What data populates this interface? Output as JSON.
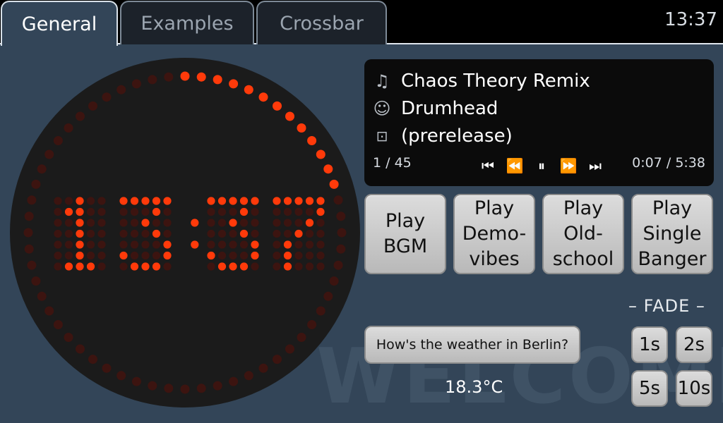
{
  "tabs": [
    {
      "label": "General",
      "active": true
    },
    {
      "label": "Examples",
      "active": false
    },
    {
      "label": "Crossbar",
      "active": false
    }
  ],
  "status_bar": {
    "time": "13:37"
  },
  "clock_display": {
    "hours": "13",
    "minutes": "37",
    "seconds_elapsed": 12,
    "lit_color": "#ff3a0a",
    "dim_color": "#3c1410",
    "face_color": "#1b1b1b"
  },
  "now_playing": {
    "title": "Chaos Theory Remix",
    "artist": "Drumhead",
    "album": "(prerelease)",
    "title_icon": "music-note-icon",
    "artist_icon": "smiley-icon",
    "album_icon": "disc-icon",
    "track_counter": "1 / 45",
    "elapsed": "0:07 / 5:38",
    "controls": {
      "previous": "⏮",
      "rewind": "⏪",
      "pause": "⏸",
      "forward": "⏩",
      "next": "⏭"
    }
  },
  "play_buttons": [
    {
      "label": "Play\nBGM"
    },
    {
      "label": "Play\nDemo-\nvibes"
    },
    {
      "label": "Play\nOld-\nschool"
    },
    {
      "label": "Play\nSingle\nBanger"
    }
  ],
  "fade": {
    "label": "– FADE –",
    "buttons": [
      "1s",
      "2s",
      "5s",
      "10s"
    ]
  },
  "weather": {
    "button_label": "How's the weather in Berlin?",
    "temperature": "18.3°C"
  },
  "watermark": "WELCOME"
}
